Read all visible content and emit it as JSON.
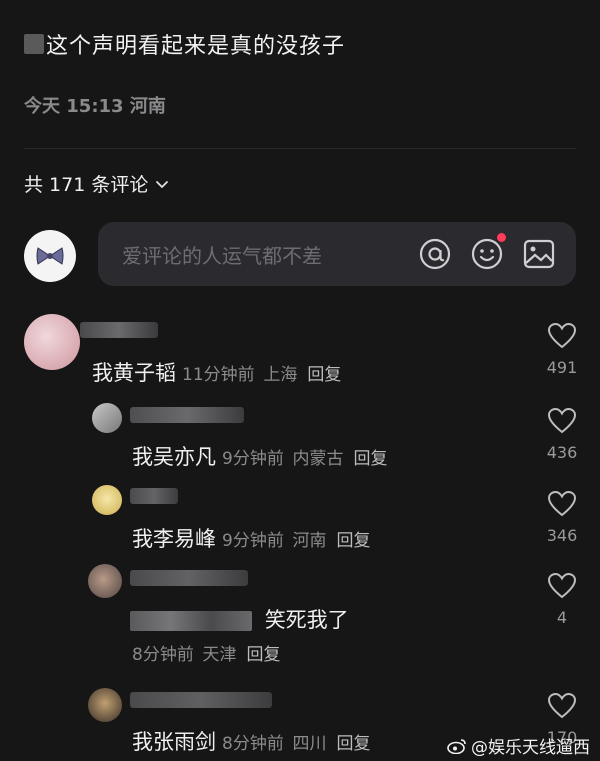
{
  "post": {
    "text": "这个声明看起来是真的没孩子",
    "meta": "今天 15:13 河南"
  },
  "comments_header": {
    "count_label": "共 171 条评论"
  },
  "composer": {
    "placeholder": "爱评论的人运气都不差"
  },
  "comments": [
    {
      "text": "我黄子韬",
      "time": "11分钟前",
      "location": "上海",
      "reply": "回复",
      "likes": "491"
    },
    {
      "text": "我吴亦凡",
      "time": "9分钟前",
      "location": "内蒙古",
      "reply": "回复",
      "likes": "436"
    },
    {
      "text": "我李易峰",
      "time": "9分钟前",
      "location": "河南",
      "reply": "回复",
      "likes": "346"
    },
    {
      "text": "笑死我了",
      "time": "8分钟前",
      "location": "天津",
      "reply": "回复",
      "likes": "4"
    },
    {
      "text": "我张雨剑",
      "time": "8分钟前",
      "location": "四川",
      "reply": "回复",
      "likes": "170"
    }
  ],
  "watermark": {
    "text": "@娱乐天线遛西"
  },
  "icons": [
    "chevron-down-icon",
    "at-icon",
    "emoji-icon",
    "image-icon",
    "heart-icon",
    "weibo-icon"
  ]
}
